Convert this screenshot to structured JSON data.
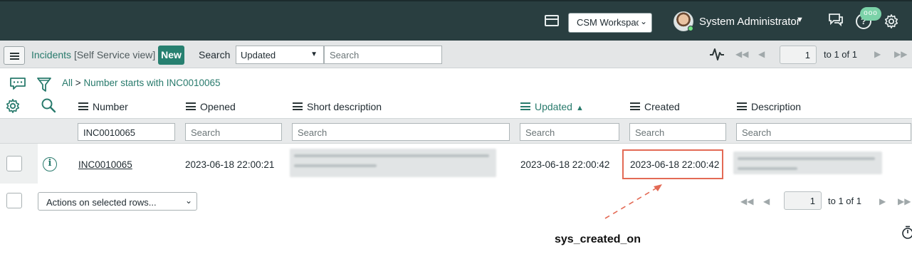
{
  "topnav": {
    "workspace_select": "CSM Workspace",
    "user_name": "System Administrator",
    "notification_badge": "ooo",
    "help_glyph": "?",
    "icons": [
      "workspace-window-icon",
      "chat-icon",
      "help-icon",
      "gear-icon"
    ],
    "background_color": "#293e40"
  },
  "listbar": {
    "title": "Incidents",
    "view": "[Self Service view]",
    "new_label": "New",
    "search_label": "Search",
    "search_field_value": "Updated",
    "search_placeholder": "Search",
    "page_value": "1",
    "page_text": "to 1 of 1"
  },
  "breadcrumb": {
    "all": "All",
    "separator": ">",
    "condition": "Number starts with INC0010065"
  },
  "columns": [
    {
      "label": "Number",
      "search": "INC0010065"
    },
    {
      "label": "Opened",
      "search": "Search"
    },
    {
      "label": "Short description",
      "search": "Search"
    },
    {
      "label": "Updated",
      "search": "Search",
      "sorted": "ascending"
    },
    {
      "label": "Created",
      "search": "Search"
    },
    {
      "label": "Description",
      "search": "Search"
    }
  ],
  "row": {
    "number": "INC0010065",
    "opened": "2023-06-18 22:00:21",
    "updated": "2023-06-18 22:00:42",
    "created": "2023-06-18 22:00:42",
    "info_glyph": "i"
  },
  "footer": {
    "actions_placeholder": "Actions on selected rows...",
    "page_value": "1",
    "page_text": "to 1 of 1"
  },
  "annotation": {
    "label": "sys_created_on",
    "color": "#e36a55"
  },
  "accent_color": "#287a6c"
}
